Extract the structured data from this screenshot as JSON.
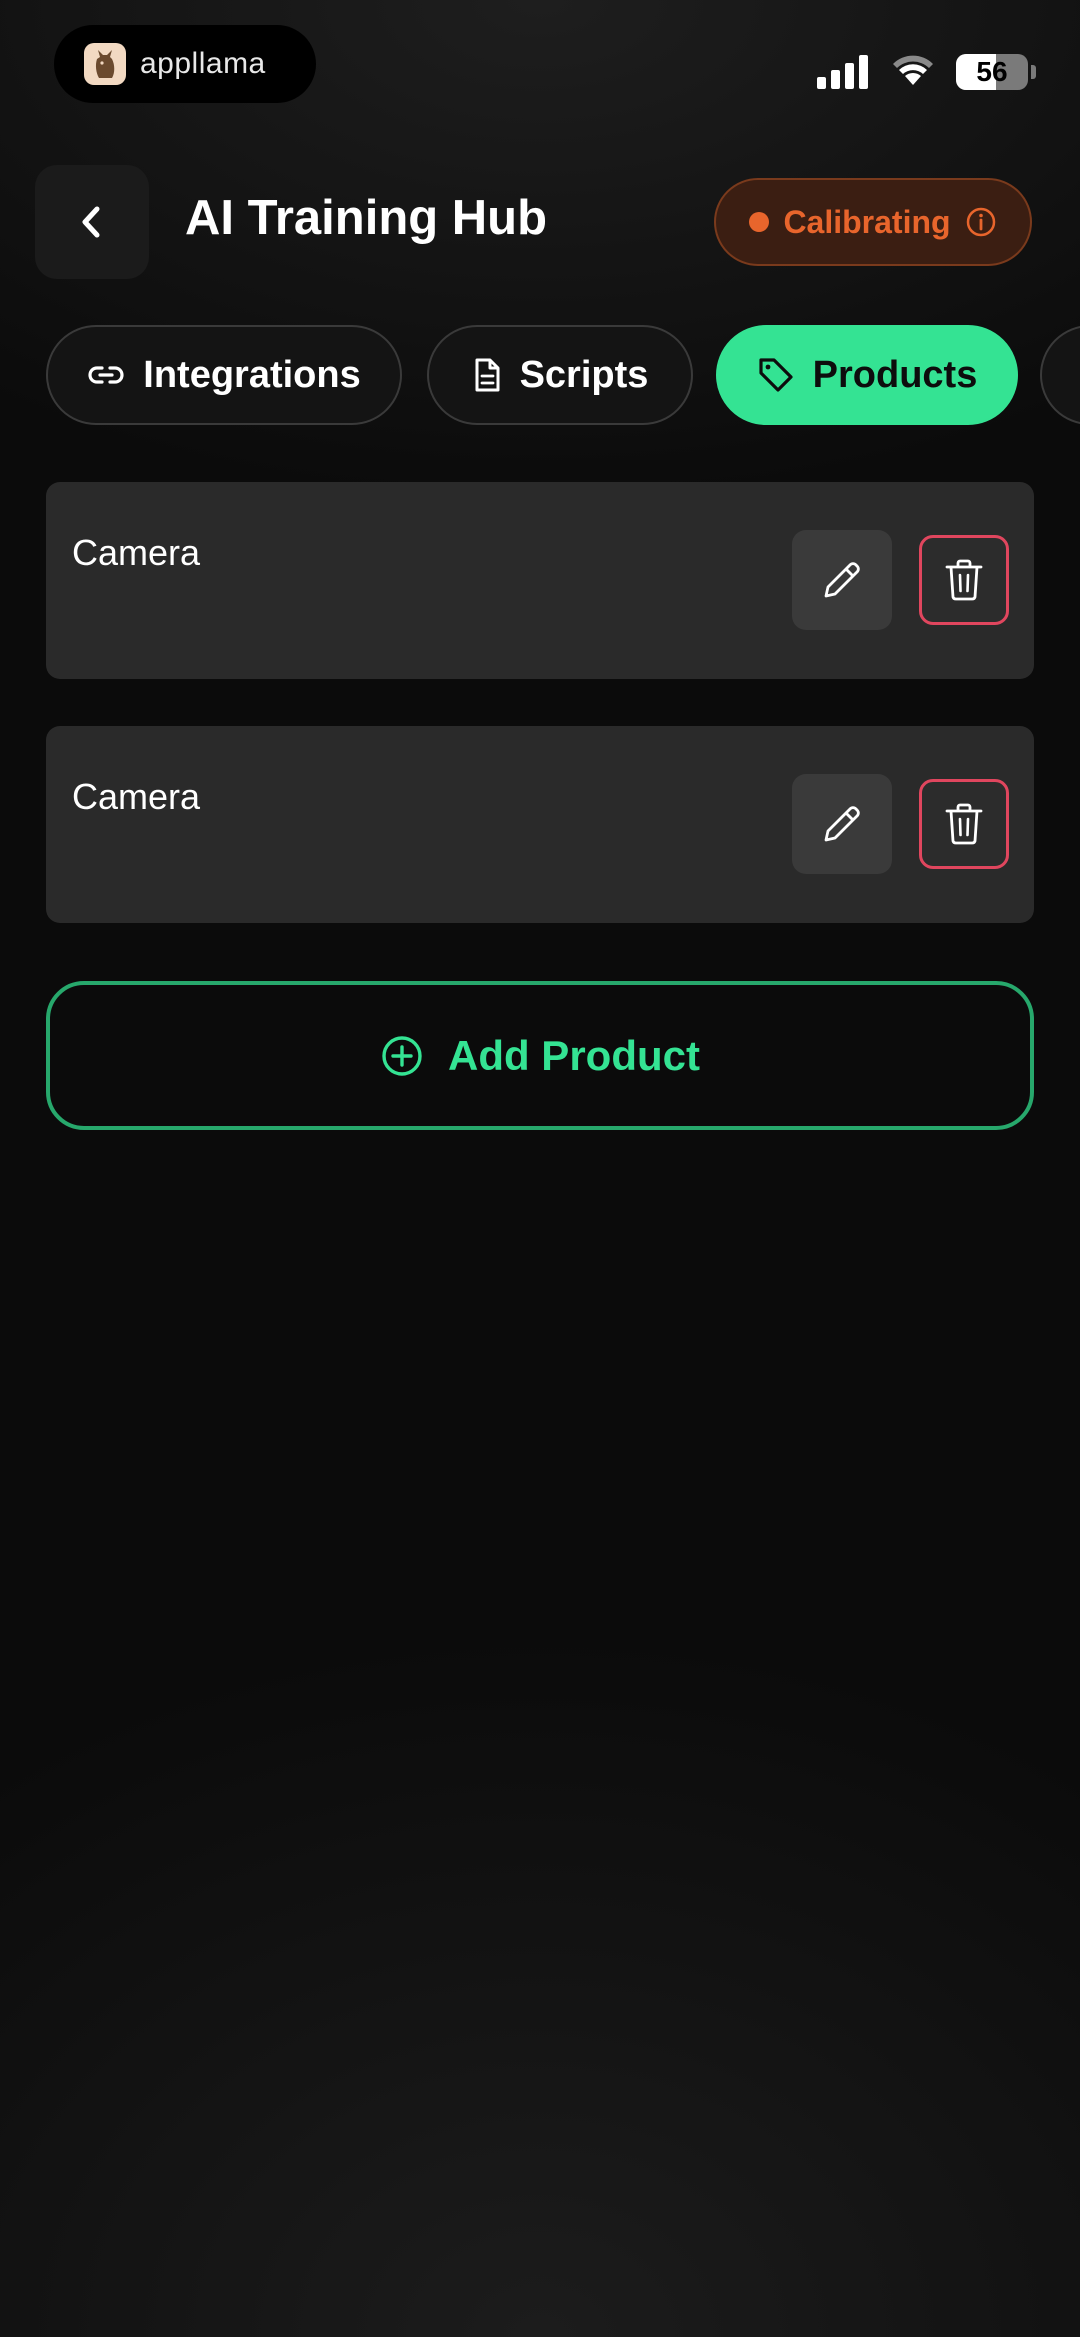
{
  "status_bar": {
    "brand_name": "appllama",
    "battery_level": "56",
    "battery_fraction": 0.56
  },
  "header": {
    "title": "AI Training Hub",
    "status_label": "Calibrating",
    "status_color": "#e8652c"
  },
  "tabs": [
    {
      "label": "Integrations",
      "icon": "link-icon",
      "active": false
    },
    {
      "label": "Scripts",
      "icon": "document-icon",
      "active": false
    },
    {
      "label": "Products",
      "icon": "tag-icon",
      "active": true
    }
  ],
  "products": [
    {
      "name": "Camera"
    },
    {
      "name": "Camera"
    }
  ],
  "add_button": {
    "label": "Add Product"
  },
  "colors": {
    "accent": "#34e393",
    "danger": "#e0465e",
    "status": "#e8652c"
  }
}
